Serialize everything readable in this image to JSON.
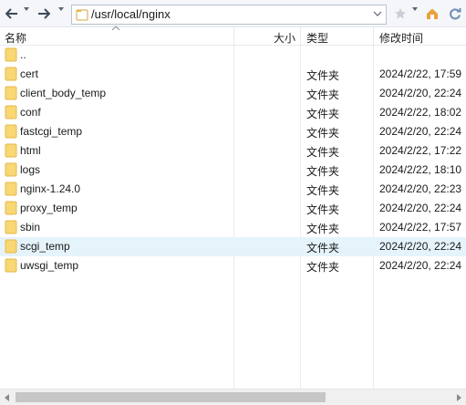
{
  "address": {
    "path": "/usr/local/nginx"
  },
  "columns": {
    "name": "名称",
    "size": "大小",
    "type": "类型",
    "modified": "修改时间"
  },
  "rows": [
    {
      "name": "..",
      "type": "",
      "modified": ""
    },
    {
      "name": "cert",
      "type": "文件夹",
      "modified": "2024/2/22, 17:59"
    },
    {
      "name": "client_body_temp",
      "type": "文件夹",
      "modified": "2024/2/20, 22:24"
    },
    {
      "name": "conf",
      "type": "文件夹",
      "modified": "2024/2/22, 18:02"
    },
    {
      "name": "fastcgi_temp",
      "type": "文件夹",
      "modified": "2024/2/20, 22:24"
    },
    {
      "name": "html",
      "type": "文件夹",
      "modified": "2024/2/22, 17:22"
    },
    {
      "name": "logs",
      "type": "文件夹",
      "modified": "2024/2/22, 18:10"
    },
    {
      "name": "nginx-1.24.0",
      "type": "文件夹",
      "modified": "2024/2/20, 22:23"
    },
    {
      "name": "proxy_temp",
      "type": "文件夹",
      "modified": "2024/2/20, 22:24"
    },
    {
      "name": "sbin",
      "type": "文件夹",
      "modified": "2024/2/22, 17:57"
    },
    {
      "name": "scgi_temp",
      "type": "文件夹",
      "modified": "2024/2/20, 22:24"
    },
    {
      "name": "uwsgi_temp",
      "type": "文件夹",
      "modified": "2024/2/20, 22:24"
    }
  ],
  "selected_row": "scgi_temp",
  "colors": {
    "folder": "#f8d775",
    "folder_dark": "#e6b84a",
    "selection": "#e5f3fb",
    "arrow": "#3c4a5c"
  },
  "icons": {
    "back": "back-arrow-icon",
    "forward": "forward-arrow-icon",
    "favorite": "star-icon",
    "home": "home-icon",
    "refresh": "refresh-icon",
    "folder": "folder-icon"
  }
}
